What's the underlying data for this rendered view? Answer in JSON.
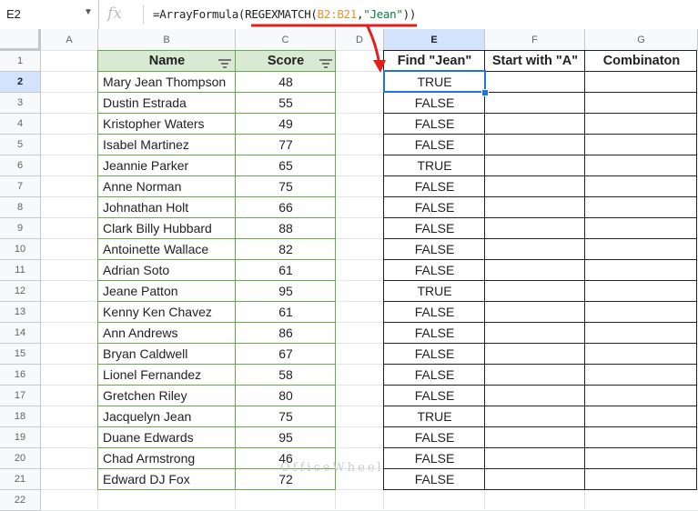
{
  "formula_bar": {
    "cell_ref": "E2",
    "fx_symbol": "fx",
    "formula_parts": [
      "=ArrayFormula(REGEXMATCH(",
      "B2:B21",
      ",",
      "\"Jean\"",
      "))"
    ]
  },
  "columns": [
    "A",
    "B",
    "C",
    "D",
    "E",
    "F",
    "G"
  ],
  "rows": [
    "1",
    "2",
    "3",
    "4",
    "5",
    "6",
    "7",
    "8",
    "9",
    "10",
    "11",
    "12",
    "13",
    "14",
    "15",
    "16",
    "17",
    "18",
    "19",
    "20",
    "21",
    "22"
  ],
  "headers": {
    "name": "Name",
    "score": "Score",
    "find_jean": "Find \"Jean\"",
    "start_with_a": "Start with \"A\"",
    "combination": "Combinaton"
  },
  "table": [
    {
      "name": "Mary Jean Thompson",
      "score": "48",
      "find": "TRUE"
    },
    {
      "name": "Dustin Estrada",
      "score": "55",
      "find": "FALSE"
    },
    {
      "name": "Kristopher Waters",
      "score": "49",
      "find": "FALSE"
    },
    {
      "name": "Isabel Martinez",
      "score": "77",
      "find": "FALSE"
    },
    {
      "name": "Jeannie Parker",
      "score": "65",
      "find": "TRUE"
    },
    {
      "name": "Anne Norman",
      "score": "75",
      "find": "FALSE"
    },
    {
      "name": "Johnathan Holt",
      "score": "66",
      "find": "FALSE"
    },
    {
      "name": "Clark Billy Hubbard",
      "score": "88",
      "find": "FALSE"
    },
    {
      "name": "Antoinette Wallace",
      "score": "82",
      "find": "FALSE"
    },
    {
      "name": "Adrian Soto",
      "score": "61",
      "find": "FALSE"
    },
    {
      "name": "Jeane Patton",
      "score": "95",
      "find": "TRUE"
    },
    {
      "name": "Kenny Ken Chavez",
      "score": "61",
      "find": "FALSE"
    },
    {
      "name": "Ann Andrews",
      "score": "86",
      "find": "FALSE"
    },
    {
      "name": "Bryan Caldwell",
      "score": "67",
      "find": "FALSE"
    },
    {
      "name": "Lionel Fernandez",
      "score": "58",
      "find": "FALSE"
    },
    {
      "name": "Gretchen Riley",
      "score": "80",
      "find": "FALSE"
    },
    {
      "name": "Jacquelyn Jean",
      "score": "75",
      "find": "TRUE"
    },
    {
      "name": "Duane Edwards",
      "score": "95",
      "find": "FALSE"
    },
    {
      "name": "Chad Armstrong",
      "score": "46",
      "find": "FALSE"
    },
    {
      "name": "Edward DJ Fox",
      "score": "72",
      "find": "FALSE"
    }
  ],
  "selected_cell": "E2",
  "watermark": "OfficeWheel",
  "colors": {
    "header_green": "#d9ead3",
    "table_border_green": "#6aa84f",
    "selection_blue": "#1a73e8",
    "annotation_red": "#e0201b",
    "range_orange": "#e8912d",
    "string_green": "#0a8043"
  }
}
